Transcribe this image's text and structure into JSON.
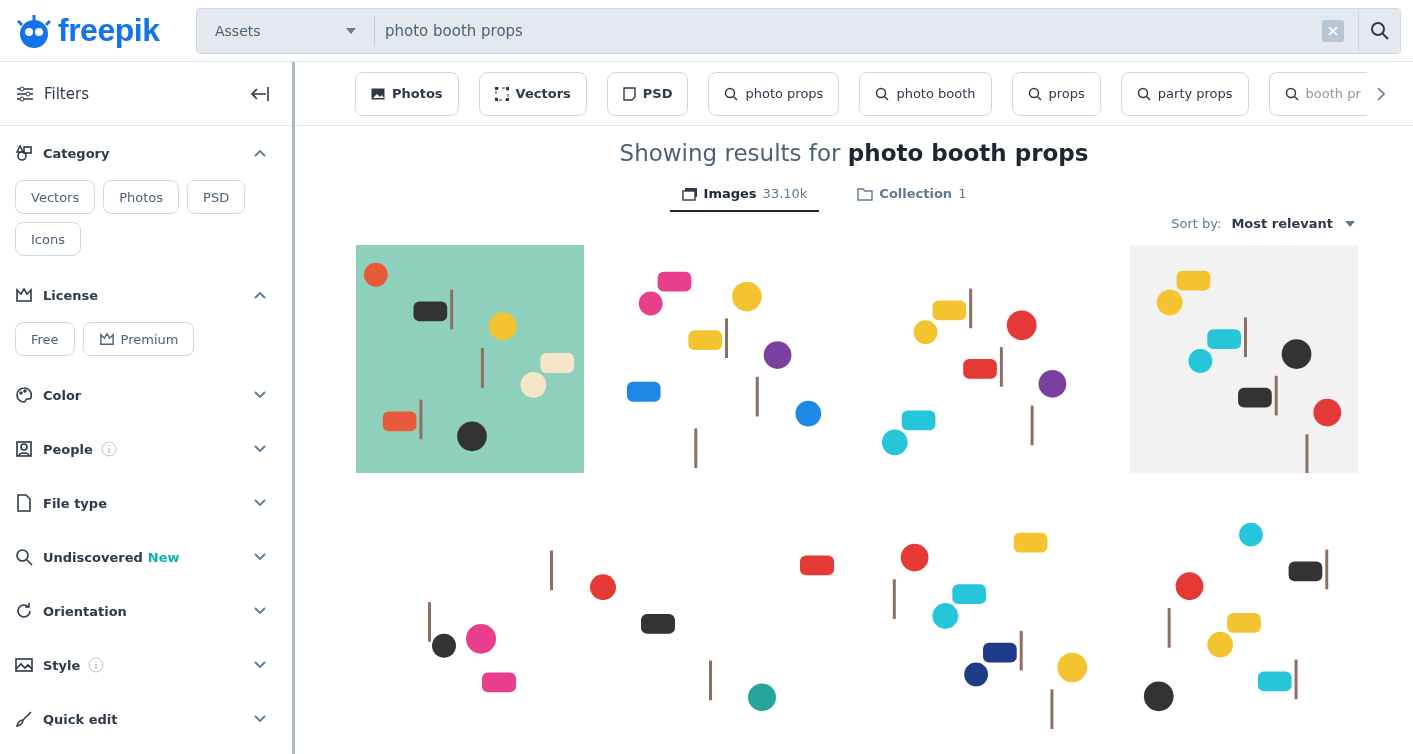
{
  "header": {
    "logo": "freepik",
    "search": {
      "scope": "Assets",
      "value": "photo booth props"
    }
  },
  "sidebar": {
    "title": "Filters",
    "sections": [
      {
        "label": "Category",
        "expanded": true,
        "chips": [
          {
            "kind": "plain",
            "label": "Vectors"
          },
          {
            "kind": "plain",
            "label": "Photos"
          },
          {
            "kind": "plain",
            "label": "PSD"
          },
          {
            "kind": "plain",
            "label": "Icons"
          }
        ]
      },
      {
        "label": "License",
        "expanded": true,
        "chips": [
          {
            "kind": "plain",
            "label": "Free"
          },
          {
            "kind": "premium",
            "label": "Premium"
          }
        ]
      },
      {
        "label": "Color",
        "expanded": false
      },
      {
        "label": "People",
        "expanded": false,
        "info": true
      },
      {
        "label": "File type",
        "expanded": false
      },
      {
        "label": "Undiscovered",
        "expanded": false,
        "badge": "New"
      },
      {
        "label": "Orientation",
        "expanded": false
      },
      {
        "label": "Style",
        "expanded": false,
        "info": true
      },
      {
        "label": "Quick edit",
        "expanded": false
      }
    ]
  },
  "chips": [
    {
      "kind": "type",
      "label": "Photos"
    },
    {
      "kind": "type",
      "label": "Vectors"
    },
    {
      "kind": "type",
      "label": "PSD"
    },
    {
      "kind": "search",
      "label": "photo props"
    },
    {
      "kind": "search",
      "label": "photo booth"
    },
    {
      "kind": "search",
      "label": "props"
    },
    {
      "kind": "search",
      "label": "party props"
    },
    {
      "kind": "search",
      "label": "booth pr"
    }
  ],
  "heading": "Showing results for **photo booth props**",
  "tabs": [
    {
      "label": "Images",
      "count": "33.10k",
      "selected": true
    },
    {
      "label": "Collection",
      "count": "1",
      "selected": false
    }
  ],
  "sort": {
    "label": "Sort by:",
    "value": "Most relevant"
  },
  "results": [
    {
      "kind": "picture",
      "wide": false
    },
    {
      "kind": "picture",
      "wide": false
    },
    {
      "kind": "picture",
      "wide": false
    },
    {
      "kind": "picture",
      "wide": false
    },
    {
      "kind": "picture",
      "wide": true
    },
    {
      "kind": "picture",
      "wide": false
    },
    {
      "kind": "picture",
      "wide": false
    }
  ]
}
